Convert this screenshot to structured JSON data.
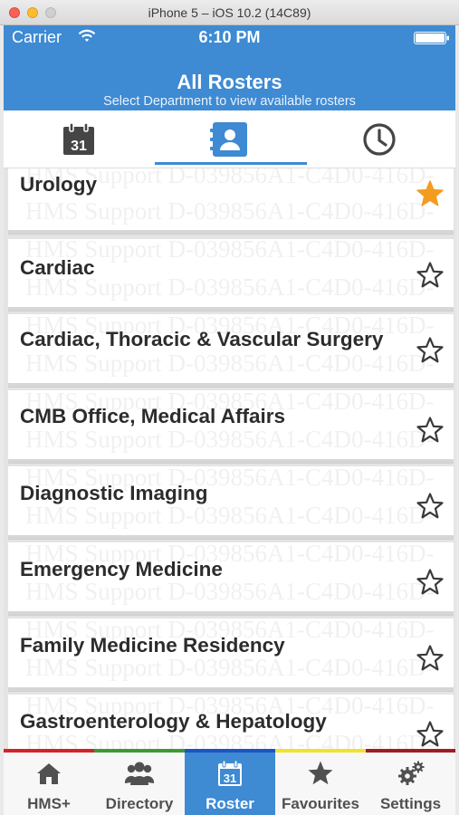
{
  "window": {
    "title": "iPhone 5 – iOS 10.2 (14C89)"
  },
  "status_bar": {
    "carrier": "Carrier",
    "time": "6:10 PM"
  },
  "nav": {
    "title": "All Rosters",
    "subtitle": "Select Department to view available rosters"
  },
  "segments": {
    "calendar_day": "31",
    "items": [
      {
        "icon": "calendar-icon"
      },
      {
        "icon": "contact-book-icon",
        "selected": true
      },
      {
        "icon": "clock-icon"
      }
    ]
  },
  "watermark_text": "HMS Support D-039856A1-C4D0-416D-",
  "departments": [
    {
      "name": "Urology",
      "favourite": true
    },
    {
      "name": "Cardiac",
      "favourite": false
    },
    {
      "name": "Cardiac, Thoracic & Vascular Surgery",
      "favourite": false
    },
    {
      "name": "CMB Office, Medical Affairs",
      "favourite": false
    },
    {
      "name": "Diagnostic Imaging",
      "favourite": false
    },
    {
      "name": "Emergency Medicine",
      "favourite": false
    },
    {
      "name": "Family Medicine Residency",
      "favourite": false
    },
    {
      "name": "Gastroenterology & Hepatology",
      "favourite": false
    }
  ],
  "tabbar": {
    "tabs": [
      {
        "label": "HMS+",
        "icon": "home-icon",
        "accent": "#d2232a"
      },
      {
        "label": "Directory",
        "icon": "people-icon",
        "accent": "#3a9b34"
      },
      {
        "label": "Roster",
        "icon": "calendar-icon",
        "accent": "#1e53c6",
        "active": true,
        "calendar_day": "31"
      },
      {
        "label": "Favourites",
        "icon": "star-icon",
        "accent": "#f1e22b"
      },
      {
        "label": "Settings",
        "icon": "gears-icon",
        "accent": "#a01c22"
      }
    ]
  },
  "colors": {
    "brand": "#3e8ad3",
    "favourite_star": "#f39c1f",
    "text": "#2c2c2c"
  }
}
